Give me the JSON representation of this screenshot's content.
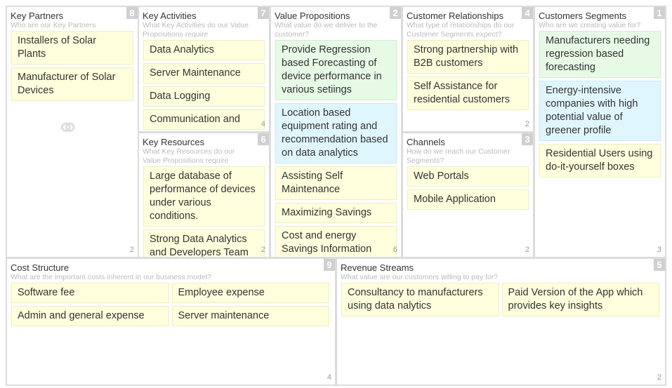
{
  "panels": {
    "kp": {
      "title": "Key Partners",
      "subtitle": "Who are our Key Partners",
      "badge": "8",
      "count": "2",
      "cards": [
        "Installers of Solar Plants",
        "Manufacturer of Solar Devices"
      ]
    },
    "ka": {
      "title": "Key Activities",
      "subtitle": "What Key Activities do our Value Propositions require",
      "badge": "7",
      "count": "4",
      "cards": [
        "Data Analytics",
        "Server Maintenance",
        "Data Logging",
        "Communication and"
      ]
    },
    "kr": {
      "title": "Key Resources",
      "subtitle": "What Key Resources do our Value Propositions require",
      "badge": "6",
      "count": "2",
      "cards": [
        "Large database of performance of devices under various conditions.",
        "Strong Data Analytics and Developers Team"
      ]
    },
    "vp": {
      "title": "Value Propositions",
      "subtitle": "What value do we deliver to the customer?",
      "badge": "2",
      "count": "6",
      "cards": [
        "Provide Regression based Forecasting of device performance in various setiings",
        "Location based equipment rating and recommendation based on data analytics",
        "Assisting Self Maintenance",
        "Maximizing Savings",
        "Cost and energy Savings Information"
      ]
    },
    "cr": {
      "title": "Customer Relationships",
      "subtitle": "What type of relationships do our Customer Segments expect?",
      "badge": "4",
      "count": "2",
      "cards": [
        "Strong partnership with B2B customers",
        "Self Assistance for residential customers"
      ]
    },
    "ch": {
      "title": "Channels",
      "subtitle": "How do we reach our Customer Segments?",
      "badge": "3",
      "count": "2",
      "cards": [
        "Web Portals",
        "Mobile Application"
      ]
    },
    "cs": {
      "title": "Customers Segments",
      "subtitle": "Who are we creating value for?",
      "badge": "1",
      "count": "3",
      "cards": [
        "Manufacturers needing regression based forecasting",
        "Energy-intensive companies with high potential value of greener profile",
        "Residential Users using do-it-yourself boxes"
      ]
    },
    "cost": {
      "title": "Cost Structure",
      "subtitle": "What are the important costs inherent in our business model?",
      "badge": "9",
      "count": "4",
      "cards": [
        "Software fee",
        "Employee expense",
        "Admin and general expense",
        "Server maintenance"
      ]
    },
    "rev": {
      "title": "Revenue Streams",
      "subtitle": "What value are our customers willing to pay for?",
      "badge": "5",
      "count": "2",
      "cards": [
        "Consultancy to manufacturers using data nalytics",
        "Paid Version of the App which provides key insights"
      ]
    }
  },
  "colors": {
    "card_default": "#ffffdd",
    "card_green": "#e6fae6",
    "card_blue": "#e0f6fd",
    "badge": "#d0d0d0"
  }
}
